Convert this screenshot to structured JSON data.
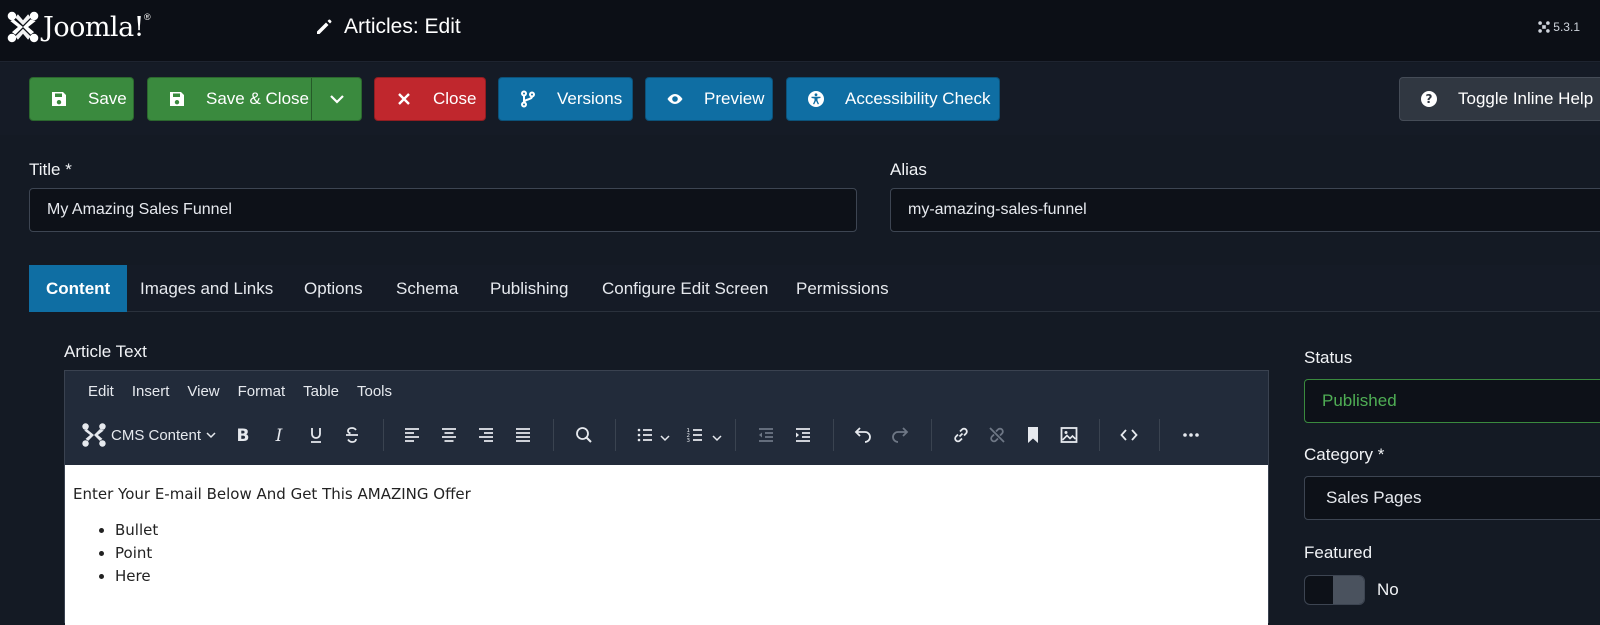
{
  "header": {
    "logo_text": "Joomla!",
    "logo_reg": "®",
    "page_title": "Articles: Edit",
    "version": "5.3.1"
  },
  "toolbar": {
    "save": "Save",
    "save_close": "Save & Close",
    "close": "Close",
    "versions": "Versions",
    "preview": "Preview",
    "accessibility_check": "Accessibility Check",
    "toggle_inline_help": "Toggle Inline Help"
  },
  "form": {
    "title_label": "Title *",
    "title_value": "My Amazing Sales Funnel",
    "alias_label": "Alias",
    "alias_value": "my-amazing-sales-funnel"
  },
  "tabs": [
    {
      "label": "Content",
      "active": true
    },
    {
      "label": "Images and Links"
    },
    {
      "label": "Options"
    },
    {
      "label": "Schema"
    },
    {
      "label": "Publishing"
    },
    {
      "label": "Configure Edit Screen"
    },
    {
      "label": "Permissions"
    }
  ],
  "editor": {
    "label": "Article Text",
    "menus": [
      "Edit",
      "Insert",
      "View",
      "Format",
      "Table",
      "Tools"
    ],
    "cms_content": "CMS Content",
    "content": {
      "paragraph": "Enter Your E-mail Below And Get This AMAZING Offer",
      "bullets": [
        "Bullet",
        "Point",
        "Here"
      ]
    }
  },
  "sidebar": {
    "status_label": "Status",
    "status_value": "Published",
    "category_label": "Category *",
    "category_value": "Sales Pages",
    "featured_label": "Featured",
    "featured_value": "No"
  },
  "colors": {
    "green": "#3a8a3e",
    "red": "#c0272d",
    "blue": "#0f6ea3",
    "status_green": "#4fae55"
  }
}
